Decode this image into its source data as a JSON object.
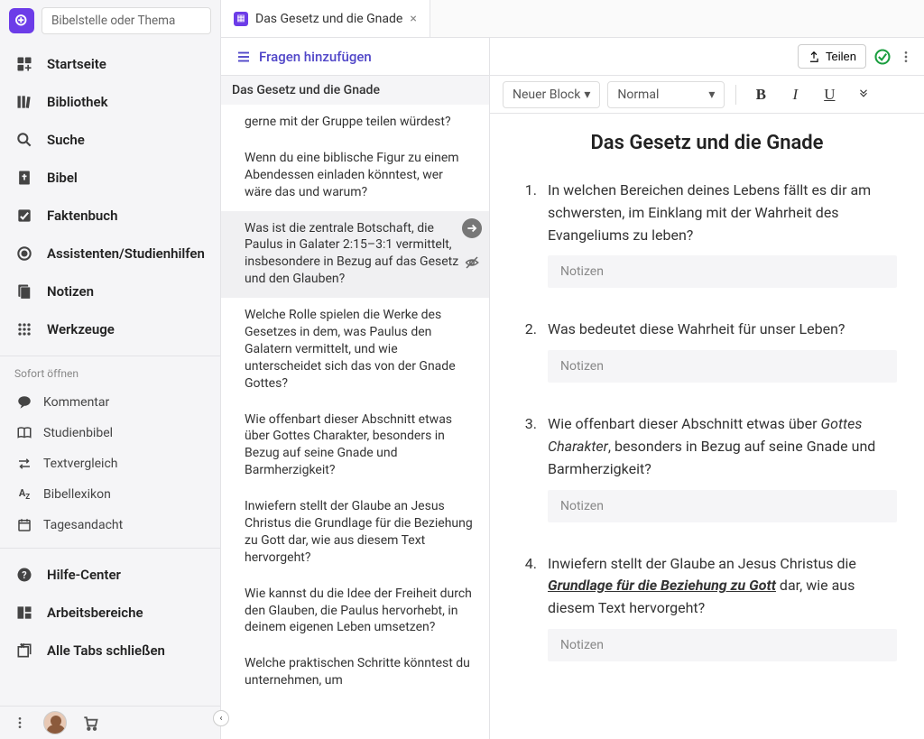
{
  "search_placeholder": "Bibelstelle oder Thema",
  "nav": {
    "home": "Startseite",
    "library": "Bibliothek",
    "search": "Suche",
    "bible": "Bibel",
    "factbook": "Faktenbuch",
    "guides": "Assistenten/Studienhilfen",
    "notes": "Notizen",
    "tools": "Werkzeuge"
  },
  "quick_open_header": "Sofort öffnen",
  "quick": {
    "commentary": "Kommentar",
    "study_bible": "Studienbibel",
    "text_compare": "Textvergleich",
    "lexicon": "Bibellexikon",
    "devotional": "Tagesandacht"
  },
  "footer_nav": {
    "help": "Hilfe-Center",
    "workspaces": "Arbeitsbereiche",
    "close_tabs": "Alle Tabs schließen"
  },
  "tab": {
    "title": "Das Gesetz und die Gnade"
  },
  "questions": {
    "add_btn": "Fragen hinzufügen",
    "panel_title": "Das Gesetz und die Gnade",
    "items": [
      "gerne mit der Gruppe teilen würdest?",
      "Wenn du eine biblische Figur zu einem Abendessen einladen könntest, wer wäre das und warum?",
      "Was ist die zentrale Botschaft, die Paulus in Galater 2:15–3:1 vermittelt, insbesondere in Bezug auf das Gesetz und den Glauben?",
      "Welche Rolle spielen die Werke des Gesetzes in dem, was Paulus den Galatern vermittelt, und wie unterscheidet sich das von der Gnade Gottes?",
      "Wie offenbart dieser Abschnitt etwas über Gottes Charakter, besonders in Bezug auf seine Gnade und Barmherzigkeit?",
      "Inwiefern stellt der Glaube an Jesus Christus die Grundlage für die Beziehung zu Gott dar, wie aus diesem Text hervorgeht?",
      "Wie kannst du die Idee der Freiheit durch den Glauben, die Paulus hervorhebt, in deinem eigenen Leben umsetzen?",
      "Welche praktischen Schritte könntest du unternehmen, um"
    ]
  },
  "editor": {
    "share": "Teilen",
    "block_dropdown": "Neuer Block",
    "style_dropdown": "Normal",
    "doc_title": "Das Gesetz und die Gnade",
    "notes_placeholder": "Notizen",
    "doc_questions": [
      {
        "num": "1.",
        "text": "In welchen Bereichen deines Lebens fällt es dir am schwersten, im Einklang mit der Wahrheit des Evangeliums zu leben?"
      },
      {
        "num": "2.",
        "text": "Was bedeutet diese Wahrheit für unser Leben?"
      },
      {
        "num": "3.",
        "html": "Wie offenbart dieser Abschnitt etwas über <em>Gottes Charakter</em>, besonders in Bezug auf seine Gnade und Barmherzigkeit?"
      },
      {
        "num": "4.",
        "html": "Inwiefern stellt der Glaube an Jesus Christus die <span class=\"ul\">Grundlage für die Beziehung zu Gott</span> dar, wie aus diesem Text hervorgeht?"
      }
    ]
  }
}
